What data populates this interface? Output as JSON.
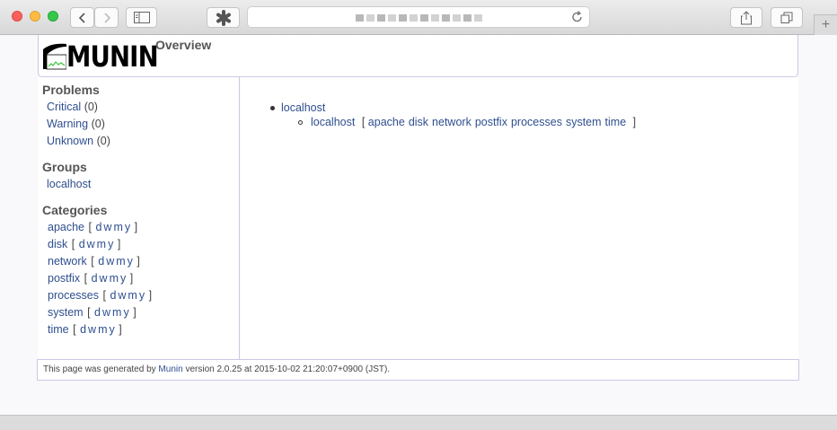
{
  "browser": {
    "colors": {
      "close": "#fc605c",
      "minimize": "#fdbc40",
      "zoom": "#34c84a"
    }
  },
  "header": {
    "logo_text": "MUNIN",
    "title": "Overview"
  },
  "sidebar": {
    "problems": {
      "title": "Problems",
      "items": [
        {
          "label": "Critical",
          "count": "(0)"
        },
        {
          "label": "Warning",
          "count": "(0)"
        },
        {
          "label": "Unknown",
          "count": "(0)"
        }
      ]
    },
    "groups": {
      "title": "Groups",
      "items": [
        {
          "label": "localhost"
        }
      ]
    },
    "categories": {
      "title": "Categories",
      "open_bracket": "[",
      "close_bracket": "]",
      "periods": [
        "d",
        "w",
        "m",
        "y"
      ],
      "items": [
        {
          "label": "apache"
        },
        {
          "label": "disk"
        },
        {
          "label": "network"
        },
        {
          "label": "postfix"
        },
        {
          "label": "processes"
        },
        {
          "label": "system"
        },
        {
          "label": "time"
        }
      ]
    }
  },
  "main": {
    "group": "localhost",
    "node": "localhost",
    "open_bracket": "[",
    "close_bracket": "]",
    "node_categories": [
      "apache",
      "disk",
      "network",
      "postfix",
      "processes",
      "system",
      "time"
    ]
  },
  "footer": {
    "prefix": "This page was generated by ",
    "link": "Munin",
    "suffix": " version 2.0.25 at 2015-10-02 21:20:07+0900 (JST)."
  }
}
